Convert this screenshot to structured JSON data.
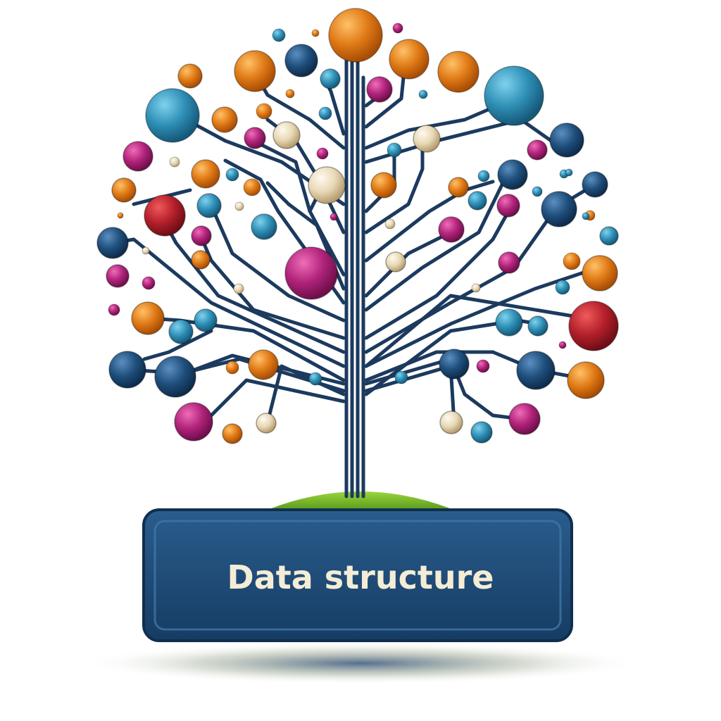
{
  "banner": {
    "text": "Data structure"
  },
  "colors": {
    "trunk": "#1c3a5e",
    "teal": "#2f8fb6",
    "navy": "#1f4f7d",
    "orange": "#e07a16",
    "magenta": "#b0237a",
    "red": "#b4202b",
    "beige": "#e8d9b6",
    "grass": "#7cc22c",
    "banner_fill": "#1c4670",
    "banner_border": "#0f2f4f",
    "banner_text": "#f4edd6",
    "shadow": "#1d3d6b"
  },
  "illustration": {
    "subject": "tree-of-nodes",
    "node_colors": [
      "orange",
      "teal",
      "navy",
      "magenta",
      "red",
      "beige"
    ]
  }
}
